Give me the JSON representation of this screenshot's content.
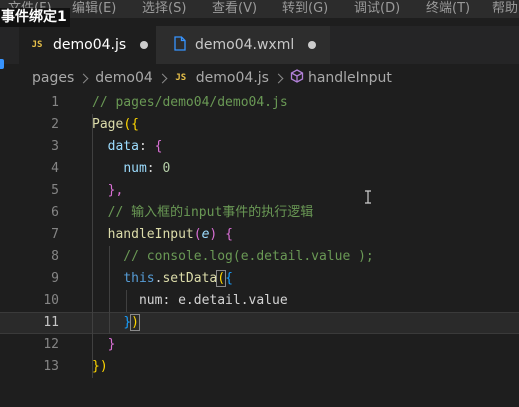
{
  "menubar": {
    "items": [
      "文件(F)",
      "编辑(E)",
      "选择(S)",
      "查看(V)",
      "转到(G)",
      "调试(D)",
      "终端(T)",
      "帮助"
    ]
  },
  "overlay_title": "事件绑定1",
  "tabs": [
    {
      "label": "demo04.js",
      "icon": "js-file-icon",
      "active": true,
      "modified": true
    },
    {
      "label": "demo04.wxml",
      "icon": "file-icon",
      "active": false,
      "modified": true
    }
  ],
  "breadcrumb": {
    "items": [
      "pages",
      "demo04",
      "demo04.js",
      "handleInput"
    ]
  },
  "editor": {
    "current_line": 11,
    "lines": [
      {
        "n": "1",
        "tokens": [
          {
            "t": "// pages/demo04/demo04.js",
            "c": "t-comment"
          }
        ]
      },
      {
        "n": "2",
        "tokens": [
          {
            "t": "Page",
            "c": "t-page"
          },
          {
            "t": "({",
            "c": "t-white"
          }
        ]
      },
      {
        "n": "3",
        "tokens": [
          {
            "t": "  ",
            "c": "t-white"
          },
          {
            "t": "data",
            "c": "t-data"
          },
          {
            "t": ": ",
            "c": "t-white"
          },
          {
            "t": "{",
            "c": "t-orange"
          }
        ]
      },
      {
        "n": "4",
        "tokens": [
          {
            "t": "    ",
            "c": "t-white"
          },
          {
            "t": "num",
            "c": "t-data"
          },
          {
            "t": ": ",
            "c": "t-white"
          },
          {
            "t": "0",
            "c": "t-green"
          }
        ]
      },
      {
        "n": "5",
        "tokens": [
          {
            "t": "  ",
            "c": "t-white"
          },
          {
            "t": "},",
            "c": "t-orange"
          }
        ]
      },
      {
        "n": "6",
        "tokens": [
          {
            "t": "  // 输入框的input事件的执行逻辑",
            "c": "t-comment"
          }
        ]
      },
      {
        "n": "7",
        "tokens": [
          {
            "t": "  ",
            "c": "t-white"
          },
          {
            "t": "handleInput",
            "c": "t-comment"
          },
          {
            "t": "(",
            "c": "t-orange"
          },
          {
            "t": "e",
            "c": "t-orange"
          },
          {
            "t": ") ",
            "c": "t-orange"
          },
          {
            "t": "{",
            "c": "t-orange"
          }
        ]
      },
      {
        "n": "8",
        "tokens": [
          {
            "t": "    // console.log(e.detail.value );",
            "c": "t-orange"
          }
        ]
      },
      {
        "n": "9",
        "tokens": [
          {
            "t": "    ",
            "c": "t-white"
          },
          {
            "t": "this",
            "c": "t-orange"
          },
          {
            "t": ".",
            "c": "t-orange"
          },
          {
            "t": "setData",
            "c": "t-orange"
          },
          {
            "t": "(",
            "c": "t-gold"
          },
          {
            "t": "{",
            "c": "t-orange"
          }
        ]
      },
      {
        "n": "10",
        "tokens": [
          {
            "t": "      num: e.detail.value",
            "c": "t-white"
          }
        ]
      },
      {
        "n": "11",
        "tokens": [
          {
            "t": "    ",
            "c": "t-white"
          },
          {
            "t": "}",
            "c": "t-orange"
          },
          {
            "t": ")",
            "c": "t-gold"
          }
        ]
      },
      {
        "n": "12",
        "tokens": [
          {
            "t": "  ",
            "c": "t-white"
          },
          {
            "t": "}",
            "c": "t-orange"
          }
        ]
      },
      {
        "n": "13",
        "tokens": [
          {
            "t": "})",
            "c": "t-white"
          }
        ]
      }
    ]
  },
  "colors": {
    "background": "#1e1e1e",
    "tabbar": "#252526",
    "accent": "#3794ff",
    "comment": "#6a9955"
  }
}
